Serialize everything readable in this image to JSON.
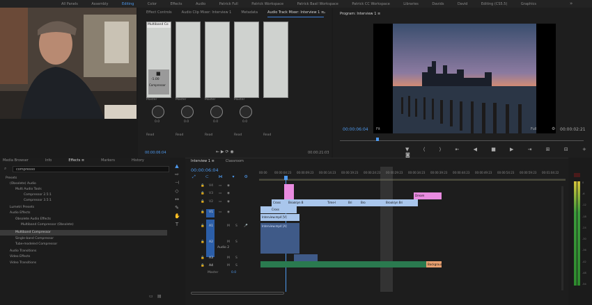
{
  "workspace": {
    "tabs": [
      "All Panels",
      "Assembly",
      "Editing",
      "Color",
      "Effects",
      "Audio",
      "Patrick Full",
      "Patrick Workspace",
      "Patrick Basil Workspace",
      "Patrick CC Workspace",
      "Libraries",
      "Davids",
      "David",
      "Editing (CS5.5)",
      "Graphics"
    ],
    "active": "Editing"
  },
  "mixer_panel": {
    "tabs": [
      "Effect Controls",
      "Audio Clip Mixer: Interview 1",
      "Metadata",
      "Audio Track Mixer: Interview 1 ≡"
    ],
    "active_tab": "Audio Track Mixer: Interview 1 ≡",
    "insert_label": "Multiband Co",
    "fader_readout": "-1.00",
    "fader_name": "Compressor",
    "channels": [
      {
        "route": "Master",
        "pan": "0.0",
        "output": "Read"
      },
      {
        "route": "Master",
        "pan": "0.0",
        "output": "Read"
      },
      {
        "route": "Master",
        "pan": "0.0",
        "output": "Read"
      },
      {
        "route": "Master",
        "pan": "0.0",
        "output": "Read"
      },
      {
        "route": "",
        "pan": "",
        "output": "Read"
      }
    ],
    "timecode_left": "00:00:06:04",
    "timecode_right": "00:00:21:03"
  },
  "program_monitor": {
    "tab": "Program: Interview 1 ≡",
    "timecode": "00:00:06:04",
    "fit": "Fit",
    "quality": "Full",
    "duration": "00:00:02:21"
  },
  "project_panel": {
    "tabs": [
      "Media Browser",
      "Info",
      "Effects ≡",
      "Markers",
      "History"
    ],
    "active_tab": "Effects ≡",
    "search_value": "compresso",
    "items": [
      {
        "text": "Presets",
        "indent": 1,
        "sel": false
      },
      {
        "text": "(Obsolete) Audio",
        "indent": 1,
        "sel": false
      },
      {
        "text": "Multi Audio Tools",
        "indent": 2,
        "sel": false
      },
      {
        "text": "Compressor 2.5:1",
        "indent": 3,
        "sel": false
      },
      {
        "text": "Compressor 3.5:1",
        "indent": 3,
        "sel": false
      },
      {
        "text": "Lumetri Presets",
        "indent": 1,
        "sel": false
      },
      {
        "text": "Audio Effects",
        "indent": 1,
        "sel": false
      },
      {
        "text": "Obsolete Audio Effects",
        "indent": 2,
        "sel": false
      },
      {
        "text": "Multiband Compressor (Obsolete)",
        "indent": 3,
        "sel": false
      },
      {
        "text": "Multiband Compressor",
        "indent": 2,
        "sel": true
      },
      {
        "text": "Single-band Compressor",
        "indent": 2,
        "sel": false
      },
      {
        "text": "Tube-modeled Compressor",
        "indent": 2,
        "sel": false
      },
      {
        "text": "Audio Transitions",
        "indent": 1,
        "sel": false
      },
      {
        "text": "Video Effects",
        "indent": 1,
        "sel": false
      },
      {
        "text": "Video Transitions",
        "indent": 1,
        "sel": false
      }
    ]
  },
  "timeline": {
    "tabs": [
      "Interview 1 ≡",
      "Classroom"
    ],
    "active_tab": "Interview 1 ≡",
    "timecode": "00:00:06:04",
    "ruler": [
      "00:00",
      "00:00:04:23",
      "00:00:09:23",
      "00:00:14:23",
      "00:00:19:23",
      "00:00:24:23",
      "00:00:29:23",
      "00:00:34:23",
      "00:00:39:23",
      "00:00:44:23",
      "00:00:49:23",
      "00:00:54:23",
      "00:00:59:23",
      "00:01:04:22"
    ],
    "tracks": [
      {
        "name": "V4"
      },
      {
        "name": "V3"
      },
      {
        "name": "V2"
      },
      {
        "name": "V1"
      },
      {
        "name": "A1"
      },
      {
        "name": "A2"
      },
      {
        "name": "A3"
      },
      {
        "name": "A4"
      }
    ],
    "a2_label": "Audio 2",
    "master_label": "Master",
    "master_value": "0.0",
    "clips": [
      {
        "label": "Cross",
        "color": "#a9c6ec"
      },
      {
        "label": "Brooklyn B",
        "color": "#a9c6ec"
      },
      {
        "label": "Time-l",
        "color": "#a9c6ec"
      },
      {
        "label": "Bri",
        "color": "#a9c6ec"
      },
      {
        "label": "Bro",
        "color": "#a9c6ec"
      },
      {
        "label": "Brooklyn Bri",
        "color": "#a9c6ec"
      },
      {
        "label": "Dream",
        "color": "#e98be0"
      },
      {
        "label": "Interview.mp4 [V]",
        "color": "#a9c6ec"
      },
      {
        "label": "Cross",
        "color": "#a9c6ec"
      },
      {
        "label": "Interview.mp4 [A]",
        "color": "#a9c6ec"
      },
      {
        "label": "Cross",
        "color": "#2a7a4f"
      },
      {
        "label": "Background",
        "color": "#2a7a4f"
      }
    ]
  },
  "meter": {
    "scale": [
      "0",
      "-6",
      "-12",
      "-18",
      "-24",
      "-30",
      "-36",
      "-42",
      "-48",
      "-54"
    ]
  }
}
